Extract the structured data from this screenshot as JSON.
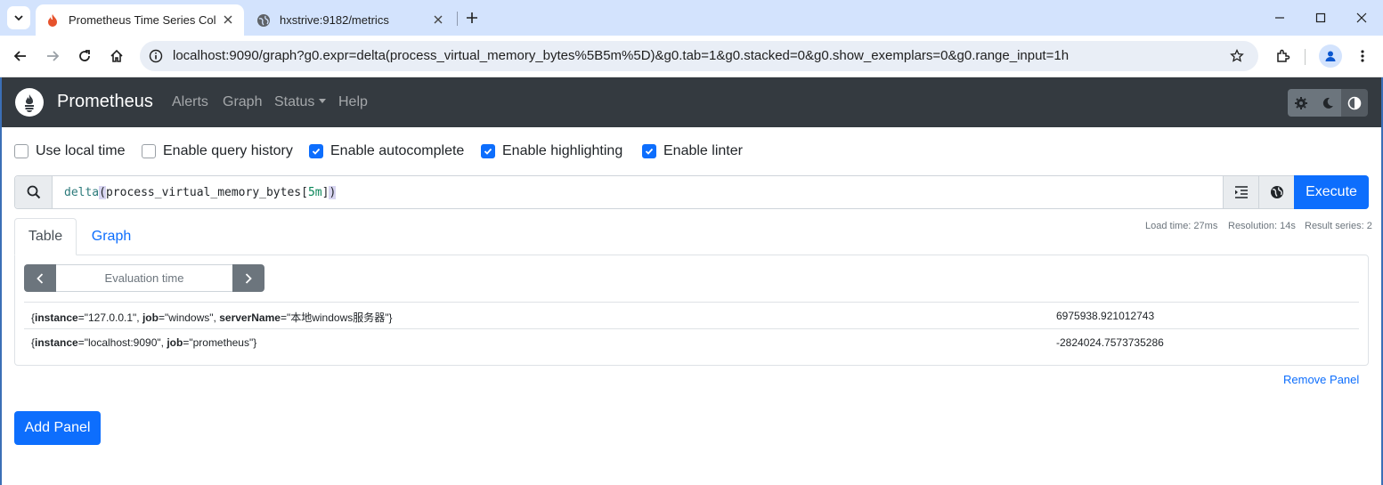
{
  "browser": {
    "tabs": [
      {
        "title": "Prometheus Time Series Colle",
        "active": true,
        "favicon": "flame-icon"
      },
      {
        "title": "hxstrive:9182/metrics",
        "active": false,
        "favicon": "globe-icon"
      }
    ],
    "address": "localhost:9090/graph?g0.expr=delta(process_virtual_memory_bytes%5B5m%5D)&g0.tab=1&g0.stacked=0&g0.show_exemplars=0&g0.range_input=1h"
  },
  "navbar": {
    "brand": "Prometheus",
    "links": {
      "alerts": "Alerts",
      "graph": "Graph",
      "status": "Status",
      "help": "Help"
    }
  },
  "options": [
    {
      "label": "Use local time",
      "checked": false
    },
    {
      "label": "Enable query history",
      "checked": false
    },
    {
      "label": "Enable autocomplete",
      "checked": true
    },
    {
      "label": "Enable highlighting",
      "checked": true
    },
    {
      "label": "Enable linter",
      "checked": true
    }
  ],
  "query": {
    "fn": "delta",
    "open": "(",
    "metric": "process_virtual_memory_bytes[",
    "duration": "5m",
    "close_bracket": "]",
    "close": ")",
    "execute_label": "Execute"
  },
  "stats": {
    "load_time": "Load time: 27ms",
    "resolution": "Resolution: 14s",
    "result_series": "Result series: 2"
  },
  "panel": {
    "tab_table": "Table",
    "tab_graph": "Graph",
    "eval_placeholder": "Evaluation time",
    "results": [
      {
        "labels": [
          {
            "k": "instance",
            "v": "127.0.0.1"
          },
          {
            "k": "job",
            "v": "windows"
          },
          {
            "k": "serverName",
            "v": "本地windows服务器"
          }
        ],
        "value": "6975938.921012743"
      },
      {
        "labels": [
          {
            "k": "instance",
            "v": "localhost:9090"
          },
          {
            "k": "job",
            "v": "prometheus"
          }
        ],
        "value": "-2824024.7573735286"
      }
    ],
    "remove_label": "Remove Panel"
  },
  "add_panel_label": "Add Panel",
  "colors": {
    "primary": "#0d6efd",
    "navbar": "#343a40",
    "tabstrip": "#d3e3fd"
  }
}
